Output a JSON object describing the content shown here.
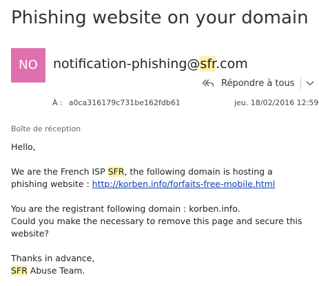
{
  "email": {
    "subject": "Phishing website on your domain",
    "avatar_initials": "NO",
    "avatar_color": "#e06fb0",
    "sender": {
      "before": "notification-phishing@",
      "highlight": "sfr",
      "after": ".com"
    },
    "reply_button_label": "Répondre à tous",
    "to_label": "À :",
    "to_value": "a0ca316179c731be162fdb61e",
    "date": "jeu. 18/02/2016 12:59",
    "folder": "Boîte de réception",
    "highlight_color": "#fbf1a6",
    "link_color": "#0b3fb3",
    "body": {
      "greeting": "Hello,",
      "p1_before": "We are the French ISP ",
      "p1_highlight": "SFR",
      "p1_after": ", the following domain is hosting a phishing website : ",
      "p1_link": "http://korben.info/forfaits-free-mobile.html",
      "p2_line1": "You are the registrant following domain : korben.info.",
      "p2_line2": "Could you make the necessary to remove this page and secure this website?",
      "closing": "Thanks in advance,",
      "signature_highlight": "SFR",
      "signature_after": " Abuse Team."
    }
  }
}
